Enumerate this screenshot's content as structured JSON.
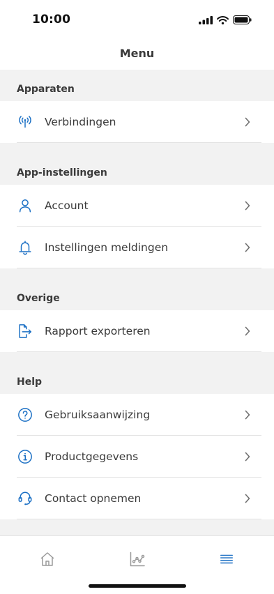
{
  "status_bar": {
    "time": "10:00"
  },
  "header": {
    "title": "Menu"
  },
  "sections": [
    {
      "title": "Apparaten",
      "items": [
        {
          "label": "Verbindingen",
          "icon": "antenna-icon"
        }
      ]
    },
    {
      "title": "App-instellingen",
      "items": [
        {
          "label": "Account",
          "icon": "user-icon"
        },
        {
          "label": "Instellingen meldingen",
          "icon": "bell-icon"
        }
      ]
    },
    {
      "title": "Overige",
      "items": [
        {
          "label": "Rapport exporteren",
          "icon": "export-icon"
        }
      ]
    },
    {
      "title": "Help",
      "items": [
        {
          "label": "Gebruiksaanwijzing",
          "icon": "question-icon"
        },
        {
          "label": "Productgegevens",
          "icon": "info-icon"
        },
        {
          "label": "Contact opnemen",
          "icon": "headset-icon"
        }
      ]
    }
  ],
  "tab_bar": {
    "tabs": [
      {
        "icon": "home-icon",
        "active": false
      },
      {
        "icon": "chart-icon",
        "active": false
      },
      {
        "icon": "menu-icon",
        "active": true
      }
    ]
  },
  "colors": {
    "accent": "#1a6fc4",
    "inactive": "#9a9a9a",
    "section_bg": "#f2f2f2",
    "divider": "#e3e3e3"
  }
}
